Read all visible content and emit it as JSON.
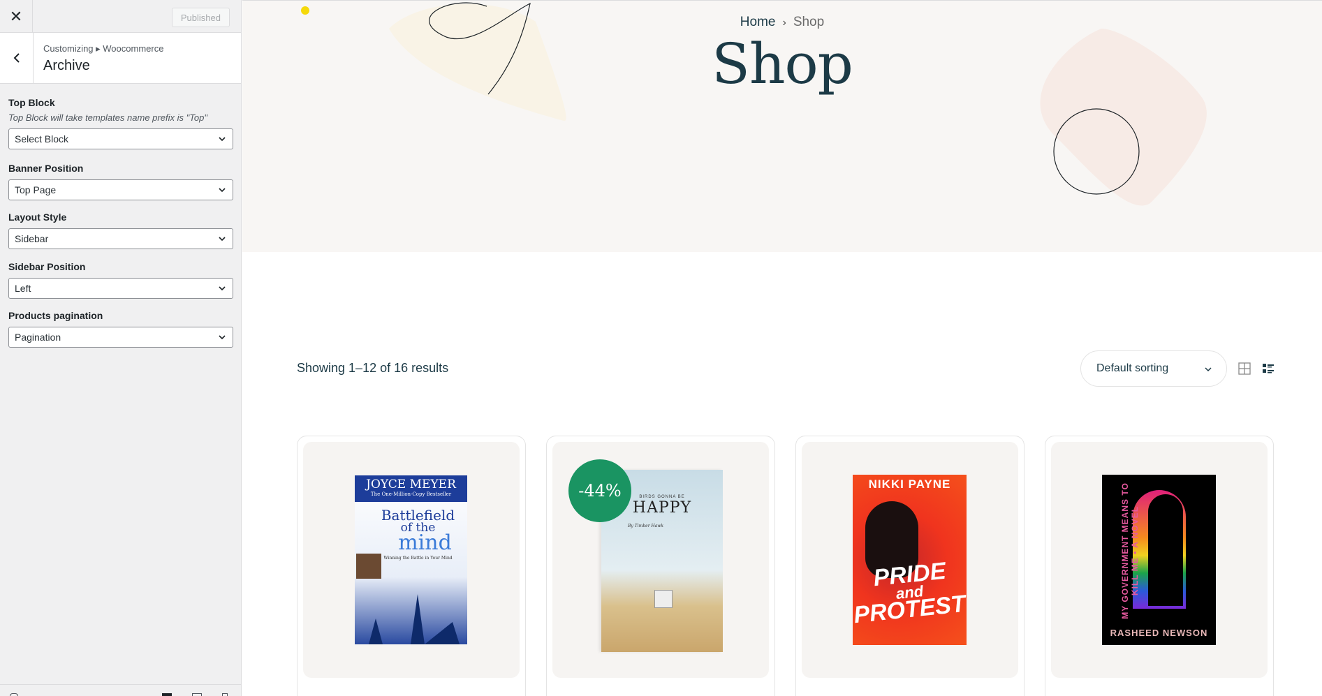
{
  "customizer": {
    "close_icon": "close-icon",
    "published_label": "Published",
    "breadcrumb": "Customizing ▸ Woocommerce",
    "section_title": "Archive",
    "controls": [
      {
        "label": "Top Block",
        "description": "Top Block will take templates name prefix is \"Top\"",
        "value": "Select Block"
      },
      {
        "label": "Banner Position",
        "value": "Top Page"
      },
      {
        "label": "Layout Style",
        "value": "Sidebar"
      },
      {
        "label": "Sidebar Position",
        "value": "Left"
      },
      {
        "label": "Products pagination",
        "value": "Pagination"
      }
    ]
  },
  "shop": {
    "breadcrumb": {
      "home": "Home",
      "separator": "›",
      "current": "Shop"
    },
    "title": "Shop",
    "results_count": "Showing 1–12 of 16 results",
    "sorting": "Default sorting",
    "view_modes": [
      "grid-view-icon",
      "list-view-icon"
    ]
  },
  "products": [
    {
      "cover_title_1": "JOYCE MEYER",
      "cover_sub": "The One-Million-Copy Bestseller",
      "cover_title_2": "Battlefield",
      "cover_title_3": "of the",
      "cover_title_4": "mind",
      "cover_tagline": "Winning the Battle in Your Mind"
    },
    {
      "badge": "-44%",
      "cover_kicker": "BIRDS GONNA BE",
      "cover_title": "HAPPY",
      "cover_author": "By Timber Hawk"
    },
    {
      "cover_author": "NIKKI PAYNE",
      "cover_title_1": "PRIDE",
      "cover_title_2": "and",
      "cover_title_3": "PROTEST"
    },
    {
      "cover_title": "MY GOVERNMENT MEANS TO KILL ME • A NOVEL",
      "cover_author": "RASHEED NEWSON"
    }
  ],
  "colors": {
    "accent": "#1c3a46",
    "sale_badge": "#1a9462",
    "banner_bg": "#f8f6f4"
  }
}
